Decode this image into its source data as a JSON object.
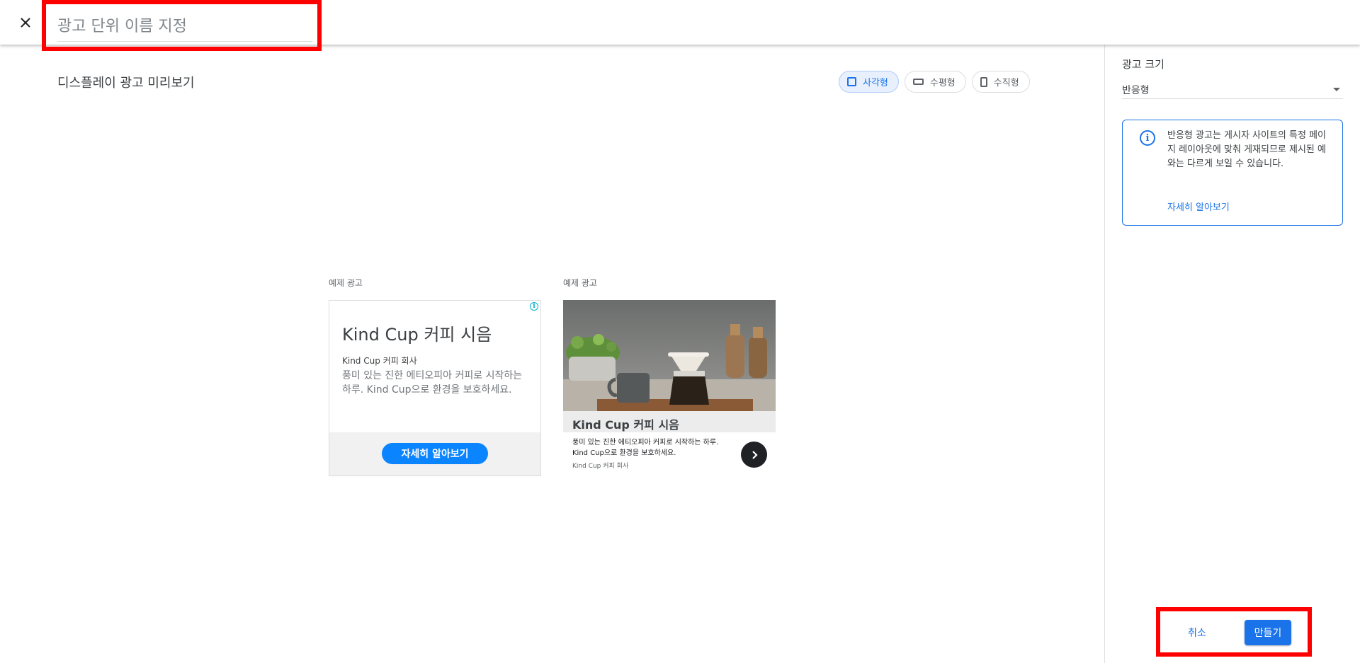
{
  "header": {
    "close_icon": "close-icon",
    "name_placeholder": "광고 단위 이름 지정"
  },
  "preview": {
    "title": "디스플레이 광고 미리보기",
    "shape_chips": [
      {
        "label": "사각형",
        "icon": "square-icon",
        "selected": true
      },
      {
        "label": "수평형",
        "icon": "horizontal-rectangle-icon",
        "selected": false
      },
      {
        "label": "수직형",
        "icon": "vertical-rectangle-icon",
        "selected": false
      }
    ],
    "ads": [
      {
        "label": "예제 광고",
        "headline": "Kind Cup 커피 시음",
        "company": "Kind Cup 커피 회사",
        "description": "풍미 있는 진한 에티오피아 커피로 시작하는 하루. Kind Cup으로 환경을 보호하세요.",
        "cta": "자세히 알아보기",
        "info_icon": "adchoices-info-icon"
      },
      {
        "label": "예제 광고",
        "headline": "Kind Cup 커피 시음",
        "description": "풍미 있는 진한 에티오피아 커피로 시작하는 하루. Kind Cup으로 환경을 보호하세요.",
        "company": "Kind Cup 커피 회사",
        "arrow_icon": "chevron-right-icon"
      }
    ]
  },
  "sidebar": {
    "size_label": "광고 크기",
    "size_value": "반응형",
    "info_text": "반응형 광고는 게시자 사이트의 특정 페이지 레이아웃에 맞춰 게재되므로 제시된 예와는 다르게 보일 수 있습니다.",
    "info_link": "자세히 알아보기"
  },
  "actions": {
    "cancel": "취소",
    "create": "만들기"
  },
  "colors": {
    "accent": "#1a73e8",
    "highlight_border": "#ff0000",
    "ad_cta": "#0a84ff"
  }
}
